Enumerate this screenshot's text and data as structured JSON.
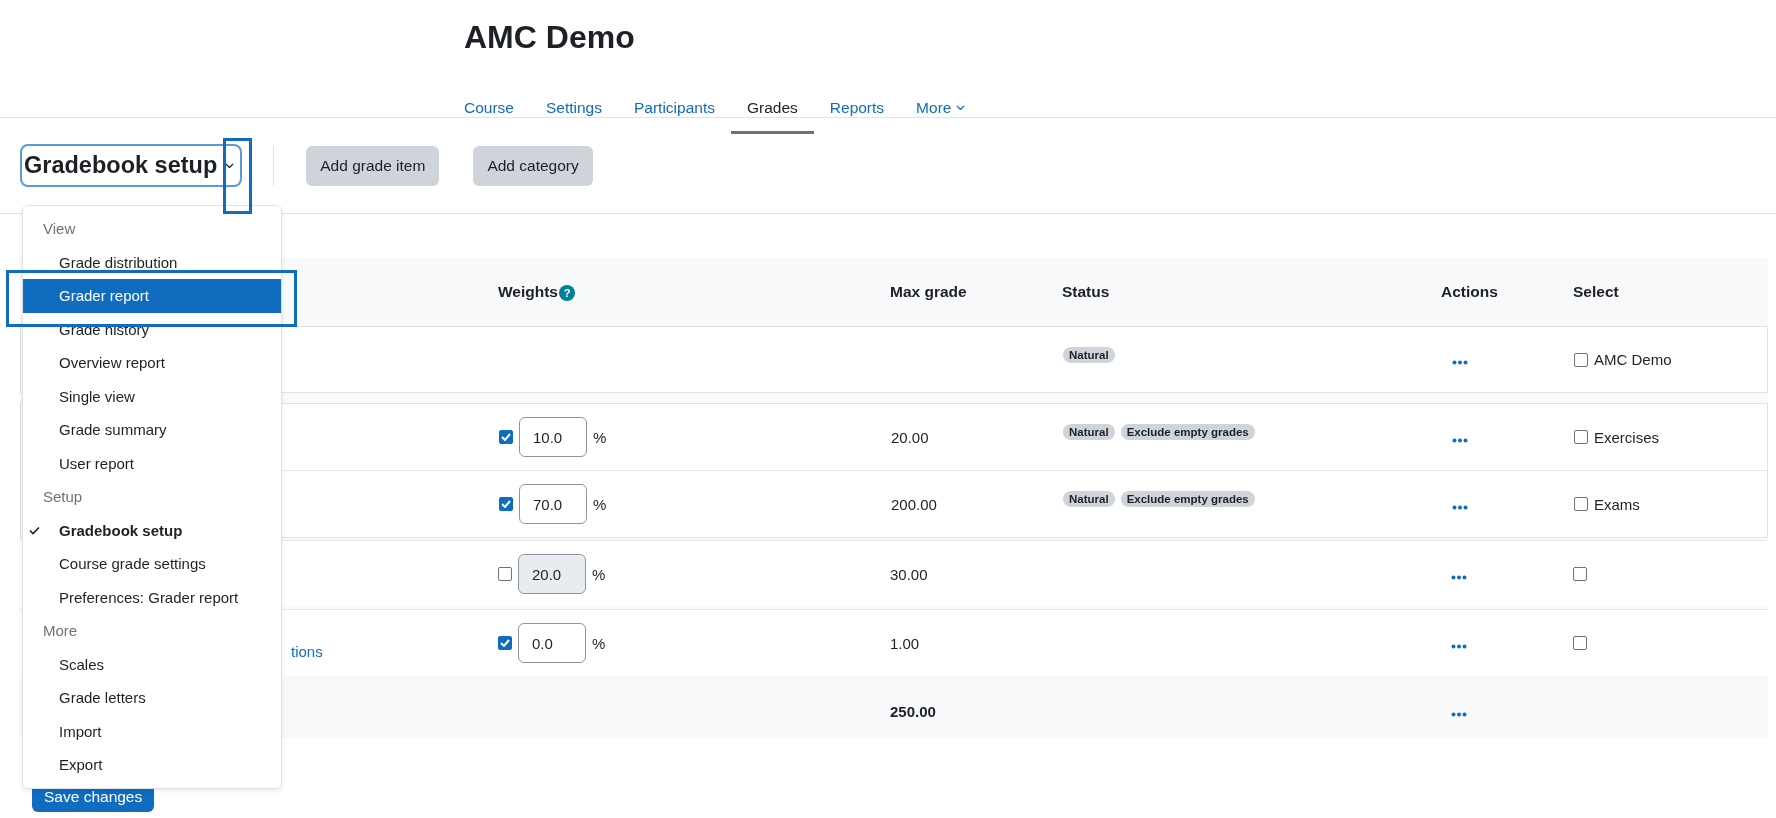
{
  "course_title": "AMC Demo",
  "nav_tabs": [
    {
      "label": "Course",
      "selected": false,
      "kind": "link"
    },
    {
      "label": "Settings",
      "selected": false,
      "kind": "link"
    },
    {
      "label": "Participants",
      "selected": false,
      "kind": "link"
    },
    {
      "label": "Grades",
      "selected": true,
      "kind": "link"
    },
    {
      "label": "Reports",
      "selected": false,
      "kind": "link"
    },
    {
      "label": "More",
      "selected": false,
      "kind": "dropdown"
    }
  ],
  "toolbar": {
    "report_selector": "Gradebook setup",
    "buttons": [
      "Add grade item",
      "Add category"
    ]
  },
  "report_menu": [
    {
      "kind": "header",
      "label": "View"
    },
    {
      "kind": "item",
      "label": "Grade distribution",
      "active": false,
      "checked": false
    },
    {
      "kind": "item",
      "label": "Grader report",
      "active": true,
      "checked": false
    },
    {
      "kind": "item",
      "label": "Grade history",
      "active": false,
      "checked": false
    },
    {
      "kind": "item",
      "label": "Overview report",
      "active": false,
      "checked": false
    },
    {
      "kind": "item",
      "label": "Single view",
      "active": false,
      "checked": false
    },
    {
      "kind": "item",
      "label": "Grade summary",
      "active": false,
      "checked": false
    },
    {
      "kind": "item",
      "label": "User report",
      "active": false,
      "checked": false
    },
    {
      "kind": "header",
      "label": "Setup"
    },
    {
      "kind": "item",
      "label": "Gradebook setup",
      "active": false,
      "checked": true
    },
    {
      "kind": "item",
      "label": "Course grade settings",
      "active": false,
      "checked": false
    },
    {
      "kind": "item",
      "label": "Preferences: Grader report",
      "active": false,
      "checked": false
    },
    {
      "kind": "header",
      "label": "More"
    },
    {
      "kind": "item",
      "label": "Scales",
      "active": false,
      "checked": false
    },
    {
      "kind": "item",
      "label": "Grade letters",
      "active": false,
      "checked": false
    },
    {
      "kind": "item",
      "label": "Import",
      "active": false,
      "checked": false
    },
    {
      "kind": "item",
      "label": "Export",
      "active": false,
      "checked": false
    }
  ],
  "table": {
    "columns": [
      {
        "label": "Weights",
        "help": "?"
      },
      {
        "label": "Max grade"
      },
      {
        "label": "Status"
      },
      {
        "label": "Actions"
      },
      {
        "label": "Select"
      }
    ],
    "rows": [
      {
        "kind": "course",
        "status": [
          "Natural"
        ],
        "select": {
          "checked": false,
          "label": "AMC Demo"
        }
      },
      {
        "kind": "category",
        "weight": {
          "checked": true,
          "value": "10.0",
          "unit": "%"
        },
        "max_grade": "20.00",
        "status": [
          "Natural",
          "Exclude empty grades"
        ],
        "select": {
          "checked": false,
          "label": "Exercises"
        }
      },
      {
        "kind": "category",
        "weight": {
          "checked": true,
          "value": "70.0",
          "unit": "%"
        },
        "max_grade": "200.00",
        "status": [
          "Natural",
          "Exclude empty grades"
        ],
        "select": {
          "checked": false,
          "label": "Exams"
        }
      },
      {
        "kind": "item",
        "weight": {
          "checked": false,
          "value": "20.0",
          "unit": "%"
        },
        "max_grade": "30.00",
        "select": {
          "checked": false
        }
      },
      {
        "kind": "item",
        "name": "tions",
        "weight": {
          "checked": true,
          "value": "0.0",
          "unit": "%"
        },
        "max_grade": "1.00",
        "select": {
          "checked": false
        }
      },
      {
        "kind": "total",
        "max_grade": "250.00"
      }
    ]
  },
  "save_button": "Save changes"
}
